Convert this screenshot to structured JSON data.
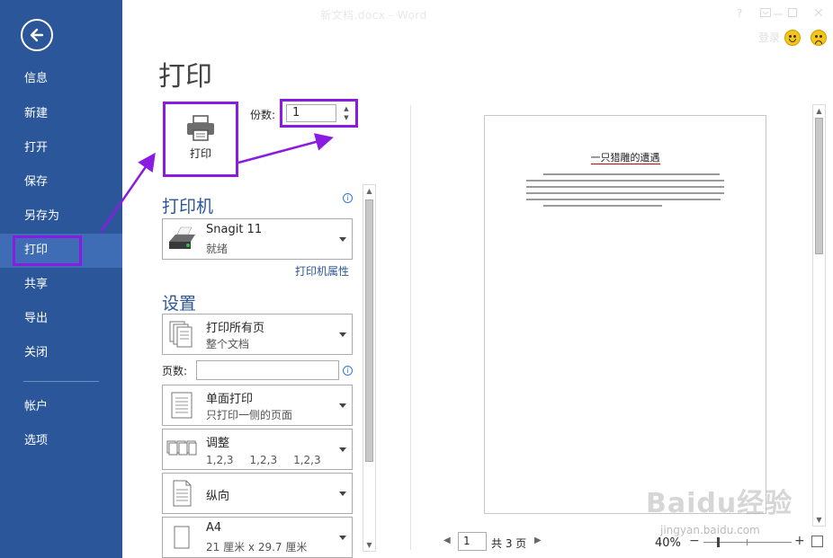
{
  "window": {
    "title": "新文档.docx - Word",
    "help_label": "?",
    "login_label": "登录",
    "icons": [
      "help-icon",
      "ribbon-display-icon",
      "minimize-icon",
      "restore-icon",
      "close-icon",
      "smile-icon",
      "frown-icon"
    ]
  },
  "nav": {
    "items": [
      {
        "label": "信息"
      },
      {
        "label": "新建"
      },
      {
        "label": "打开"
      },
      {
        "label": "保存"
      },
      {
        "label": "另存为"
      },
      {
        "label": "打印"
      },
      {
        "label": "共享"
      },
      {
        "label": "导出"
      },
      {
        "label": "关闭"
      },
      {
        "label": "帐户"
      },
      {
        "label": "选项"
      }
    ],
    "active": "打印",
    "accent_color": "#2b579a",
    "highlight_color": "#8a1be0"
  },
  "print": {
    "title": "打印",
    "print_button_label": "打印",
    "copies_label": "份数:",
    "copies_value": "1",
    "printer_heading": "打印机",
    "printer": {
      "name": "Snagit 11",
      "status": "就绪"
    },
    "printer_properties_link": "打印机属性",
    "settings_heading": "设置",
    "pages_label": "页数:",
    "settings": [
      {
        "title": "打印所有页",
        "subtitle": "整个文档",
        "icon": "pages-icon"
      },
      {
        "title": "单面打印",
        "subtitle": "只打印一侧的页面",
        "icon": "one-sided-icon"
      },
      {
        "title": "调整",
        "subtitle": [
          "1,2,3",
          "1,2,3",
          "1,2,3"
        ],
        "icon": "collate-icon"
      },
      {
        "title": "纵向",
        "subtitle": "",
        "icon": "portrait-icon"
      },
      {
        "title": "A4",
        "subtitle": "21 厘米 x 29.7 厘米",
        "icon": "paper-size-icon"
      }
    ]
  },
  "preview": {
    "doc_title": "一只猎雕的遭遇",
    "current_page": "1",
    "total_pages": "共 3 页",
    "zoom": "40%",
    "zoom_level": 0.4
  },
  "watermark": {
    "brand": "Baidu经验",
    "url": "jingyan.baidu.com"
  }
}
